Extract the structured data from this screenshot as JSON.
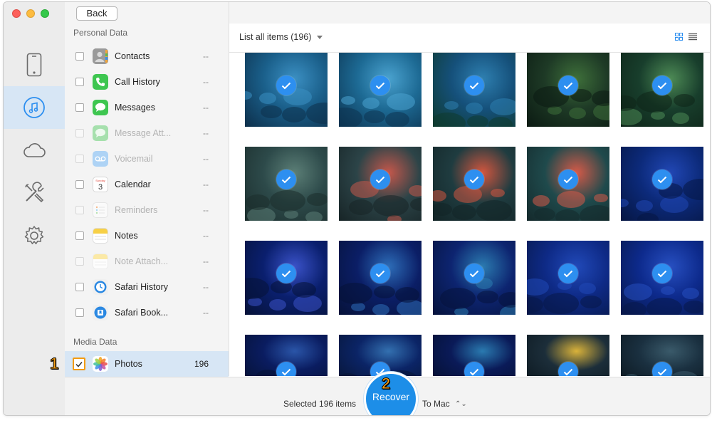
{
  "window": {
    "back_label": "Back"
  },
  "sidebar": {
    "items": [
      {
        "icon": "phone-icon",
        "active": false
      },
      {
        "icon": "music-icon",
        "active": true
      },
      {
        "icon": "cloud-icon",
        "active": false
      },
      {
        "icon": "tools-icon",
        "active": false
      },
      {
        "icon": "gear-icon",
        "active": false
      }
    ]
  },
  "categories": {
    "personal_title": "Personal Data",
    "media_title": "Media Data",
    "personal": [
      {
        "label": "Contacts",
        "count": "--",
        "icon": "contacts-icon",
        "enabled": true
      },
      {
        "label": "Call History",
        "count": "--",
        "icon": "phone-call-icon",
        "enabled": true
      },
      {
        "label": "Messages",
        "count": "--",
        "icon": "messages-icon",
        "enabled": true
      },
      {
        "label": "Message Att...",
        "count": "--",
        "icon": "message-attachment-icon",
        "enabled": false
      },
      {
        "label": "Voicemail",
        "count": "--",
        "icon": "voicemail-icon",
        "enabled": false
      },
      {
        "label": "Calendar",
        "count": "--",
        "icon": "calendar-icon",
        "enabled": true
      },
      {
        "label": "Reminders",
        "count": "--",
        "icon": "reminders-icon",
        "enabled": false
      },
      {
        "label": "Notes",
        "count": "--",
        "icon": "notes-icon",
        "enabled": true
      },
      {
        "label": "Note Attach...",
        "count": "--",
        "icon": "note-attachment-icon",
        "enabled": false
      },
      {
        "label": "Safari History",
        "count": "--",
        "icon": "safari-history-icon",
        "enabled": true
      },
      {
        "label": "Safari Book...",
        "count": "--",
        "icon": "safari-bookmark-icon",
        "enabled": true
      }
    ],
    "media": [
      {
        "label": "Photos",
        "count": "196",
        "icon": "photos-icon",
        "checked": true
      }
    ]
  },
  "main": {
    "list_label": "List all items (196)",
    "photos_count_visible": 20
  },
  "footer": {
    "selected_text": "Selected 196 items",
    "recover_label": "Recover",
    "destination": "To Mac"
  },
  "annotations": {
    "step1": "1",
    "step2": "2"
  },
  "colors": {
    "accent": "#1d8ee8",
    "check": "#2d8ff0",
    "step_badge": "#f39c12",
    "active_row": "#d7e6f5"
  }
}
